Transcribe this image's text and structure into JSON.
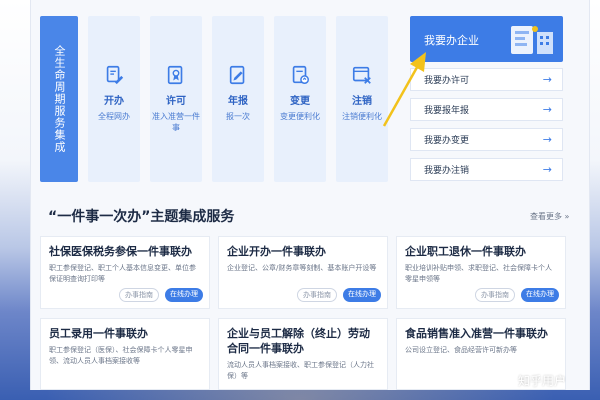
{
  "lifecycle": {
    "label": "全生命周期服务集成"
  },
  "services": [
    {
      "title": "开办",
      "sub": "全程网办",
      "icon": "document-edit-icon"
    },
    {
      "title": "许可",
      "sub": "准入准营一件事",
      "icon": "certificate-icon"
    },
    {
      "title": "年报",
      "sub": "报一次",
      "icon": "report-pen-icon"
    },
    {
      "title": "变更",
      "sub": "变更便利化",
      "icon": "document-change-icon"
    },
    {
      "title": "注销",
      "sub": "注销便利化",
      "icon": "cancel-window-icon"
    }
  ],
  "quick": {
    "main": "我要办企业",
    "links": [
      {
        "label": "我要办许可",
        "arrow": "→"
      },
      {
        "label": "我要报年报",
        "arrow": "→"
      },
      {
        "label": "我要办变更",
        "arrow": "→"
      },
      {
        "label": "我要办注销",
        "arrow": "→"
      }
    ]
  },
  "section": {
    "title": "“一件事一次办”主题集成服务",
    "more": "查看更多 »"
  },
  "buttons": {
    "guide": "办事指南",
    "online": "在线办理"
  },
  "cards": [
    {
      "title": "社保医保税务参保一件事联办",
      "desc": "职工参保登记、职工个人基本信息变更、单位参保证明查询打印等"
    },
    {
      "title": "企业开办一件事联办",
      "desc": "企业登记、公章/财务章等刻制、基本账户开设等"
    },
    {
      "title": "企业职工退休一件事联办",
      "desc": "职业培训补贴申领、求职登记、社会保障卡个人零星申领等"
    },
    {
      "title": "员工录用一件事联办",
      "desc": "职工参保登记（医保）、社会保障卡个人零星申领、流动人员人事档案接收等"
    },
    {
      "title": "企业与员工解除（终止）劳动合同一件事联办",
      "desc": "流动人员人事档案接收、职工参保登记（人力社保）等"
    },
    {
      "title": "食品销售准入准营一件事联办",
      "desc": "公司设立登记、食品经营许可新办等"
    }
  ],
  "watermark": "知乎用户",
  "colors": {
    "accent": "#3d7ce6",
    "lifecycle": "#4a86e8",
    "tile": "#e8f0fc",
    "annotation_arrow": "#f2c21b"
  }
}
